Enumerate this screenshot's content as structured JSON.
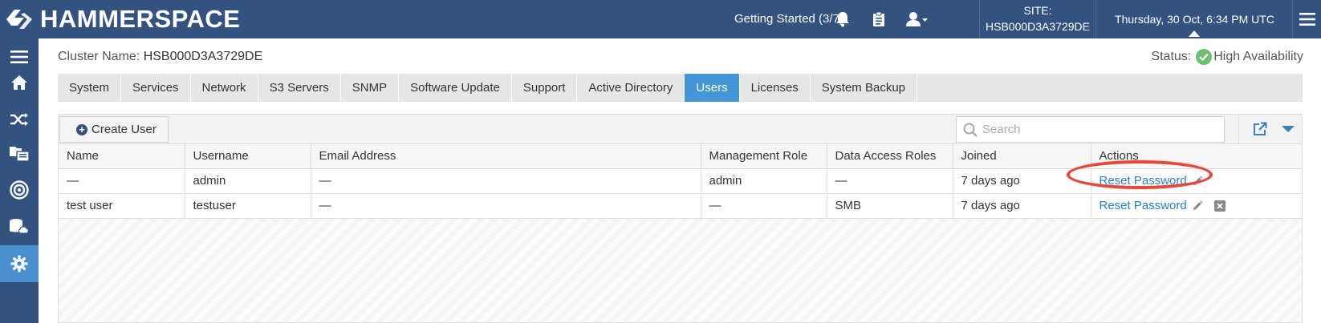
{
  "header": {
    "brand": "HAMMERSPACE",
    "getting_started": "Getting Started (3/7)",
    "site_label": "SITE:",
    "site_value": "HSB000D3A3729DE",
    "datetime": "Thursday, 30 Oct, 6:34 PM UTC"
  },
  "sidebar": {
    "items": [
      {
        "icon": "menu-icon"
      },
      {
        "icon": "home-icon"
      },
      {
        "icon": "shuffle-icon"
      },
      {
        "icon": "files-icon"
      },
      {
        "icon": "target-icon"
      },
      {
        "icon": "storage-icon"
      },
      {
        "icon": "gear-icon",
        "active": true
      }
    ]
  },
  "cluster": {
    "label": "Cluster Name:",
    "name": "HSB000D3A3729DE",
    "status_label": "Status:",
    "status_value": "High Availability"
  },
  "tabs": [
    {
      "label": "System"
    },
    {
      "label": "Services"
    },
    {
      "label": "Network"
    },
    {
      "label": "S3 Servers"
    },
    {
      "label": "SNMP"
    },
    {
      "label": "Software Update"
    },
    {
      "label": "Support"
    },
    {
      "label": "Active Directory"
    },
    {
      "label": "Users",
      "active": true
    },
    {
      "label": "Licenses"
    },
    {
      "label": "System Backup"
    }
  ],
  "toolbar": {
    "create_label": "Create User",
    "search_placeholder": "Search"
  },
  "table": {
    "columns": [
      "Name",
      "Username",
      "Email Address",
      "Management Role",
      "Data Access Roles",
      "Joined",
      "Actions"
    ],
    "rows": [
      {
        "name": "—",
        "username": "admin",
        "email": "—",
        "mgmt_role": "admin",
        "data_roles": "—",
        "joined": "7 days ago",
        "action": "Reset Password",
        "deletable": false
      },
      {
        "name": "test user",
        "username": "testuser",
        "email": "—",
        "mgmt_role": "—",
        "data_roles": "SMB",
        "joined": "7 days ago",
        "action": "Reset Password",
        "deletable": true
      }
    ]
  },
  "colors": {
    "navy": "#34527f",
    "accent_blue": "#4596d6",
    "link_blue": "#2a7fd0",
    "status_green": "#6cc070",
    "highlight_red": "#e04a3a"
  }
}
